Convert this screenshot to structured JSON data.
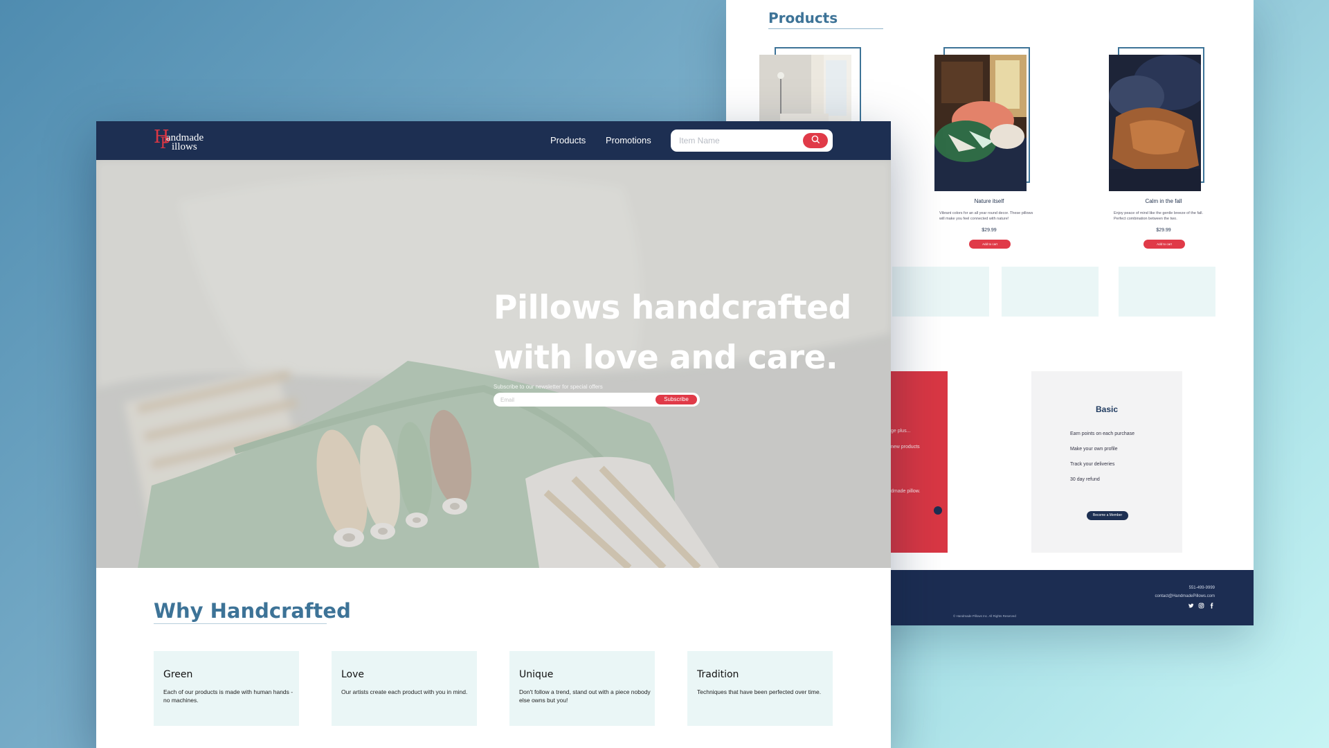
{
  "back": {
    "products_title": "Products",
    "products": [
      {
        "name": "",
        "desc": "",
        "price": "",
        "btn": ""
      },
      {
        "name": "Nature itself",
        "desc": "Vibrant colors for an all year round decor. These pillows will make you feel connected with nature!",
        "price": "$29.99",
        "btn": "Add to cart"
      },
      {
        "name": "Calm in the fall",
        "desc": "Enjoy peace of mind like the gentle breeze of the fall. Perfect combination between the two.",
        "price": "$29.99",
        "btn": "Add to cart"
      }
    ],
    "plan_red": {
      "title_fragment": "!",
      "line1": "ge plus...",
      "line2": "new products",
      "line3": "dmade pillow."
    },
    "plan_basic": {
      "title": "Basic",
      "features": [
        "Earn points on each purchase",
        "Make your own profile",
        "Track your deliveries",
        "30 day refund"
      ],
      "button": "Become a Member"
    },
    "footer": {
      "phone": "551-499-9999",
      "email": "contact@HandmadePillows.com",
      "copyright": "© Handmade Pillows Inc. All Rights Reserved"
    }
  },
  "front": {
    "logo": {
      "letter1": "H",
      "letter2": "P",
      "word1": "andmade",
      "word2": "illows"
    },
    "nav": {
      "products": "Products",
      "promotions": "Promotions"
    },
    "search": {
      "placeholder": "Item Name"
    },
    "hero": {
      "title": "Pillows handcrafted with love and care.",
      "subtitle": "Subscribe to our newsletter for special offers",
      "email_placeholder": "Email",
      "subscribe": "Subscribe"
    },
    "why": {
      "title": "Why Handcrafted",
      "cards": [
        {
          "title": "Green",
          "desc": "Each of our products is made with human hands - no machines."
        },
        {
          "title": "Love",
          "desc": "Our artists create each product with you in mind."
        },
        {
          "title": "Unique",
          "desc": "Don't follow a trend, stand out with a piece nobody else owns but you!"
        },
        {
          "title": "Tradition",
          "desc": "Techniques that have been perfected over time."
        }
      ]
    }
  },
  "colors": {
    "navy": "#1d2f52",
    "accent_red": "#e03a48",
    "heading_blue": "#3d7397",
    "card_bg": "#eaf6f6"
  },
  "icons": {
    "search": "search-icon",
    "twitter": "twitter-icon",
    "instagram": "instagram-icon",
    "facebook": "facebook-icon"
  }
}
